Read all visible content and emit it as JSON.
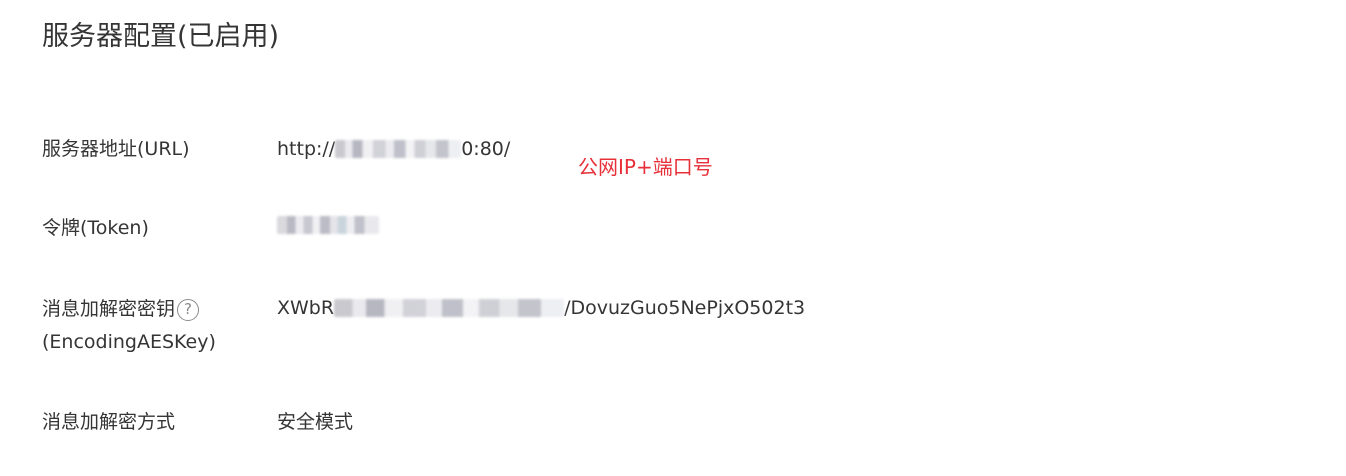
{
  "page_title": "服务器配置(已启用)",
  "rows": [
    {
      "label": "服务器地址(URL)",
      "value_prefix": "http://",
      "value_suffix": "0:80/"
    },
    {
      "label": "令牌(Token)"
    },
    {
      "label_line1": "消息加解密密钥",
      "label_line2": "(EncodingAESKey)",
      "help_icon": "?",
      "value_prefix": "XWbR",
      "value_suffix": "/DovuzGuo5NePjxO502t3"
    },
    {
      "label": "消息加解密方式",
      "value": "安全模式"
    }
  ],
  "annotation": {
    "text": "公网IP+端口号",
    "color": "#e8303a"
  }
}
